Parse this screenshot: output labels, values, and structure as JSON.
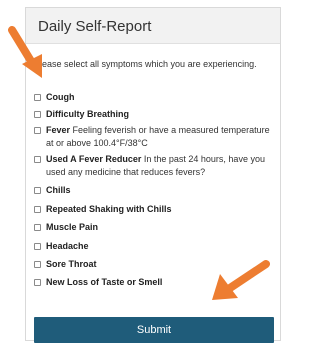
{
  "card": {
    "title": "Daily Self-Report",
    "instructions": "Please select all symptoms which you are experiencing."
  },
  "symptoms": [
    {
      "label": "Cough",
      "description": "",
      "checked": false
    },
    {
      "label": "Difficulty Breathing",
      "description": "",
      "checked": false
    },
    {
      "label": "Fever",
      "description": " Feeling feverish or have a measured temperature at or above 100.4°F/38°C",
      "checked": false
    },
    {
      "label": "Used A Fever Reducer",
      "description": " In the past 24 hours, have you used any medicine that reduces fevers?",
      "checked": false
    },
    {
      "label": "Chills",
      "description": "",
      "checked": false
    },
    {
      "label": "Repeated Shaking with Chills",
      "description": "",
      "checked": false
    },
    {
      "label": "Muscle Pain",
      "description": "",
      "checked": false
    },
    {
      "label": "Headache",
      "description": "",
      "checked": false
    },
    {
      "label": "Sore Throat",
      "description": "",
      "checked": false
    },
    {
      "label": "New Loss of Taste or Smell",
      "description": "",
      "checked": false
    }
  ],
  "submit": {
    "label": "Submit"
  },
  "colors": {
    "button": "#1f5c7a",
    "arrow": "#ed7d31",
    "header": "#f2f2f2"
  },
  "icons": {
    "arrow_top": "arrow-down-right-icon",
    "arrow_bottom": "arrow-down-left-icon"
  }
}
